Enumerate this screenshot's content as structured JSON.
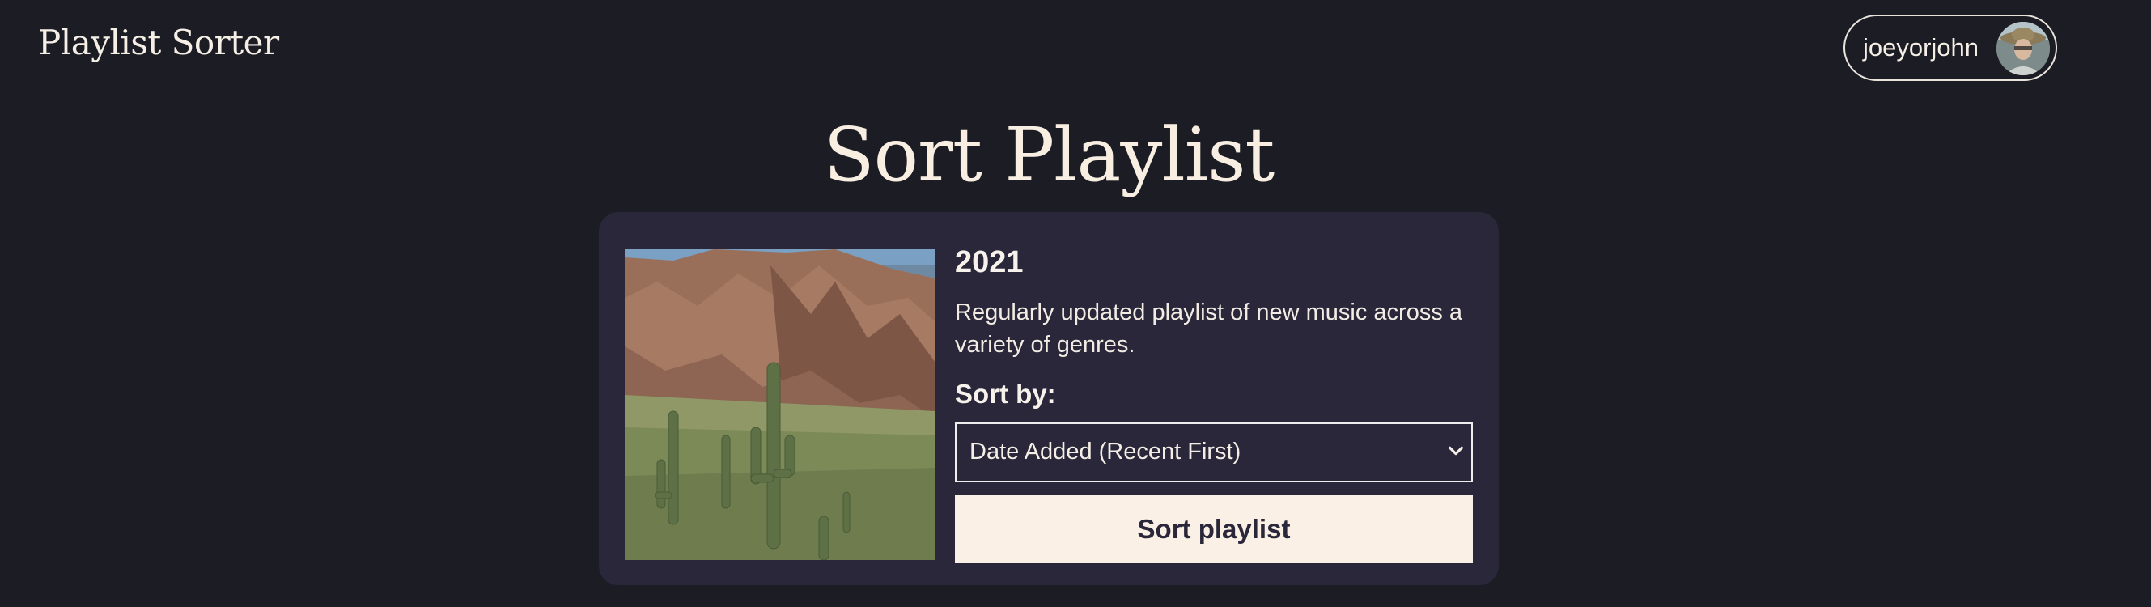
{
  "header": {
    "brand": "Playlist Sorter",
    "user": {
      "name": "joeyorjohn",
      "avatar_icon": "user-avatar"
    }
  },
  "main": {
    "title": "Sort Playlist",
    "playlist": {
      "name": "2021",
      "description": "Regularly updated playlist of new music across a variety of genres.",
      "cover_icon": "desert-cactus-photo"
    },
    "sort": {
      "label": "Sort by:",
      "selected": "Date Added (Recent First)",
      "button_label": "Sort playlist"
    }
  },
  "colors": {
    "background": "#1c1c24",
    "card": "#292739",
    "accent_button": "#faf0e6",
    "text": "#f5eee6"
  }
}
